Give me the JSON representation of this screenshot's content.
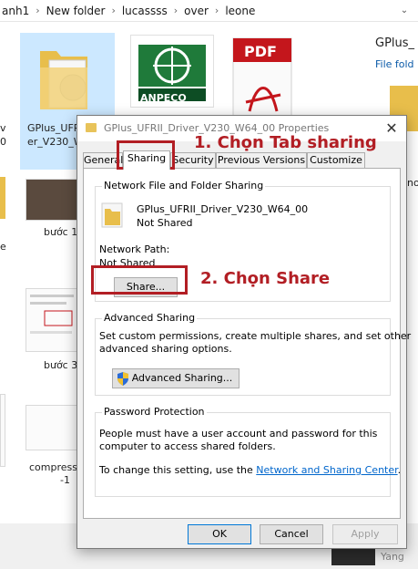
{
  "address_bar": {
    "crumbs": [
      "anh1",
      "New folder",
      "lucassss",
      "over",
      "leone"
    ]
  },
  "explorer": {
    "items": [
      {
        "label_line1": "GPlus_UFR",
        "label_line2": "er_V230_W"
      },
      {
        "label": "bước 1"
      },
      {
        "label": "bước 3"
      },
      {
        "label_line1": "compress-",
        "label_line2": "-1"
      }
    ],
    "left_partial": [
      "v",
      "0",
      "e"
    ],
    "right_folder": {
      "title": "GPlus_",
      "subtitle": "File fold"
    },
    "right_partial": "no",
    "logo_text": "ANPECO",
    "pdf_text": "PDF",
    "bottom_text": "Yang"
  },
  "dialog": {
    "title": "GPlus_UFRII_Driver_V230_W64_00 Properties",
    "close_glyph": "✕",
    "tabs": [
      "General",
      "Sharing",
      "Security",
      "Previous Versions",
      "Customize"
    ],
    "active_tab": "Sharing",
    "network_sharing": {
      "group_title": "Network File and Folder Sharing",
      "folder_name": "GPlus_UFRII_Driver_V230_W64_00",
      "status": "Not Shared",
      "path_label": "Network Path:",
      "path_value": "Not Shared",
      "share_button": "Share..."
    },
    "advanced_sharing": {
      "group_title": "Advanced Sharing",
      "description_line1": "Set custom permissions, create multiple shares, and set other",
      "description_line2": "advanced sharing options.",
      "button": "Advanced Sharing..."
    },
    "password_protection": {
      "group_title": "Password Protection",
      "line1": "People must have a user account and password for this",
      "line2": "computer to access shared folders.",
      "line3_prefix": "To change this setting, use the ",
      "link": "Network and Sharing Center",
      "line3_suffix": "."
    },
    "footer": {
      "ok": "OK",
      "cancel": "Cancel",
      "apply": "Apply"
    }
  },
  "annotations": {
    "step1": "1. Chọn Tab sharing",
    "step2": "2. Chọn Share"
  },
  "colors": {
    "annotation_red": "#b21e24",
    "link_blue": "#0066cc",
    "selection": "#cce8ff"
  }
}
